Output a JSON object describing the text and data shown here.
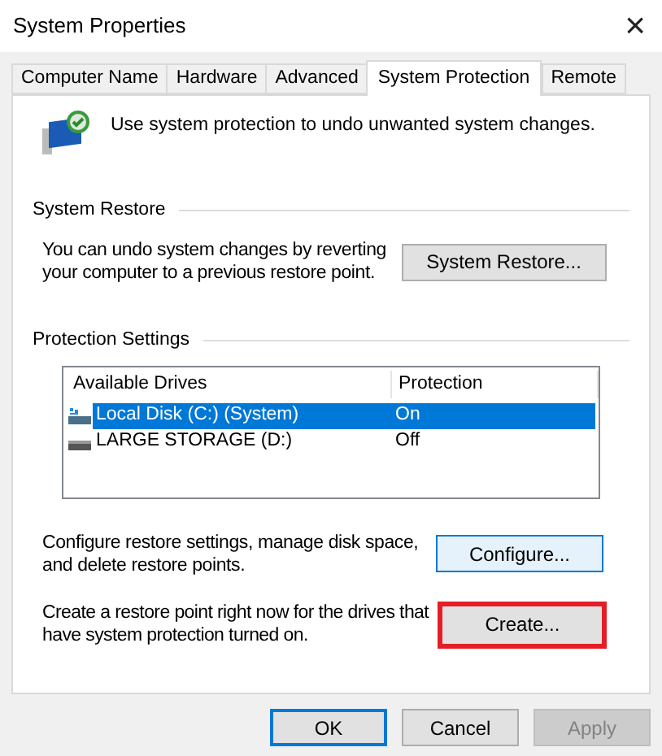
{
  "window": {
    "title": "System Properties",
    "close": "×"
  },
  "tabs": [
    {
      "label": "Computer Name",
      "selected": false
    },
    {
      "label": "Hardware",
      "selected": false
    },
    {
      "label": "Advanced",
      "selected": false
    },
    {
      "label": "System Protection",
      "selected": true
    },
    {
      "label": "Remote",
      "selected": false
    }
  ],
  "intro": "Use system protection to undo unwanted system changes.",
  "system_restore": {
    "heading": "System Restore",
    "text": "You can undo system changes by reverting your computer to a previous restore point.",
    "button": "System Restore..."
  },
  "protection_settings": {
    "heading": "Protection Settings",
    "columns": [
      "Available Drives",
      "Protection"
    ],
    "rows": [
      {
        "drive": "Local Disk (C:) (System)",
        "protection": "On",
        "selected": true,
        "kind": "system"
      },
      {
        "drive": "LARGE STORAGE (D:)",
        "protection": "Off",
        "selected": false,
        "kind": "storage"
      }
    ],
    "configure": {
      "text": "Configure restore settings, manage disk space, and delete restore points.",
      "button": "Configure...",
      "focused": true
    },
    "create": {
      "text": "Create a restore point right now for the drives that have system protection turned on.",
      "button": "Create...",
      "highlighted": true
    }
  },
  "buttons": [
    {
      "label": "OK",
      "default": true,
      "disabled": false
    },
    {
      "label": "Cancel",
      "default": false,
      "disabled": false
    },
    {
      "label": "Apply",
      "default": false,
      "disabled": true
    }
  ]
}
